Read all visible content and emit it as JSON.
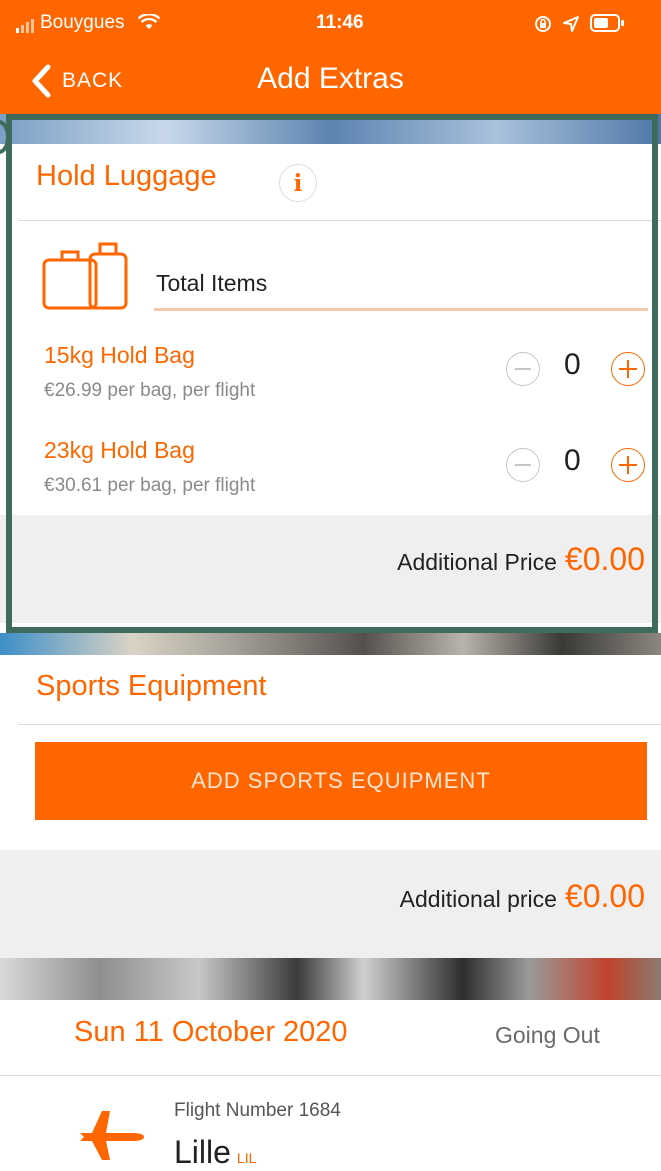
{
  "status_bar": {
    "carrier": "Bouygues",
    "time": "11:46"
  },
  "nav": {
    "back_label": "BACK",
    "title": "Add Extras"
  },
  "hold_luggage": {
    "title": "Hold Luggage",
    "total_items_label": "Total Items",
    "bags": [
      {
        "name": "15kg Hold Bag",
        "price": "€26.99 per bag, per flight",
        "quantity": "0"
      },
      {
        "name": "23kg Hold Bag",
        "price": "€30.61 per bag, per flight",
        "quantity": "0"
      }
    ],
    "additional_price_label": "Additional Price",
    "additional_price_value": "€0.00"
  },
  "sports_equipment": {
    "title": "Sports Equipment",
    "button_label": "ADD SPORTS EQUIPMENT",
    "additional_price_label": "Additional price",
    "additional_price_value": "€0.00"
  },
  "flight": {
    "date": "Sun 11 October 2020",
    "direction": "Going Out",
    "flight_number": "Flight Number 1684",
    "city": "Lille",
    "city_code": "LIL"
  },
  "colors": {
    "accent": "#ff6600",
    "highlight_border": "#3f6b5c"
  }
}
